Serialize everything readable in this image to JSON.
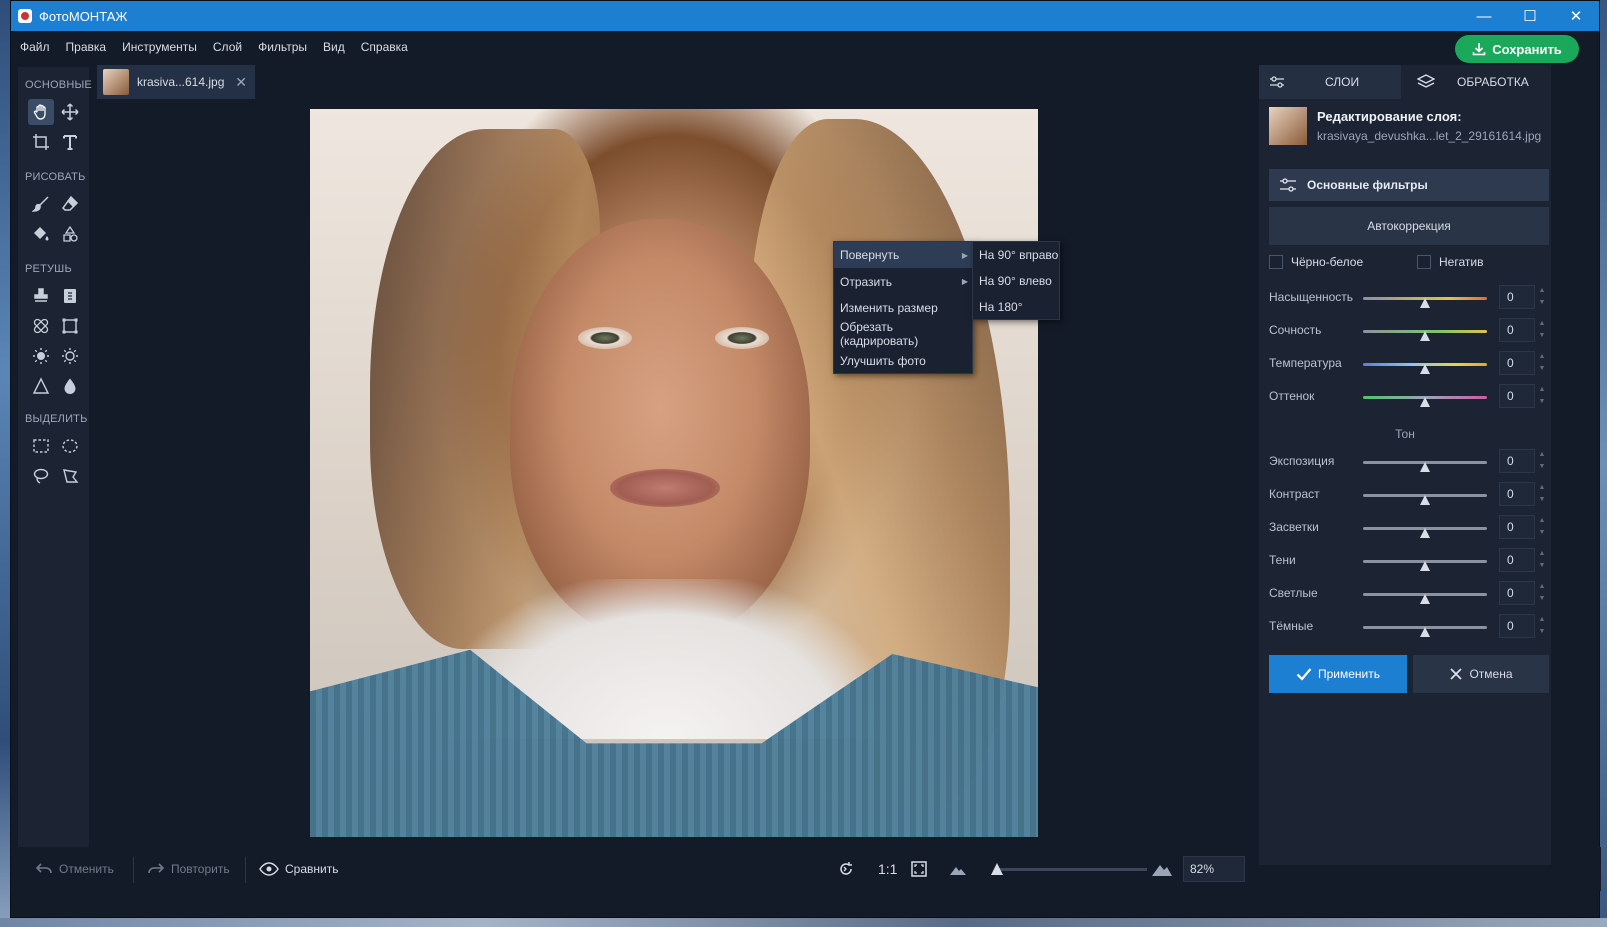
{
  "window": {
    "title": "ФотоМОНТАЖ",
    "minimize": "—",
    "maximize": "☐",
    "close": "✕"
  },
  "menu": [
    "Файл",
    "Правка",
    "Инструменты",
    "Слой",
    "Фильтры",
    "Вид",
    "Справка"
  ],
  "save_label": "Сохранить",
  "toolbox": {
    "sections": [
      "ОСНОВНЫЕ",
      "РИСОВАТЬ",
      "РЕТУШЬ",
      "ВЫДЕЛИТЬ"
    ]
  },
  "document_tab": {
    "name": "krasiva...614.jpg",
    "close": "✕"
  },
  "context_menu": {
    "items": [
      "Повернуть",
      "Отразить",
      "Изменить размер",
      "Обрезать (кадрировать)",
      "Улучшить фото"
    ],
    "submenu": [
      "На 90° вправо",
      "На 90° влево",
      "На 180°"
    ]
  },
  "bottom": {
    "undo": "Отменить",
    "redo": "Повторить",
    "compare": "Сравнить",
    "one_to_one": "1:1",
    "zoom": "82%"
  },
  "right_panel": {
    "tabs": [
      "СЛОИ",
      "ОБРАБОТКА"
    ],
    "layer_title": "Редактирование слоя:",
    "layer_file": "krasivaya_devushka...let_2_29161614.jpg",
    "section": "Основные фильтры",
    "auto": "Автокоррекция",
    "checks": [
      "Чёрно-белое",
      "Негатив"
    ],
    "color_sliders": [
      {
        "label": "Насыщенность",
        "value": "0"
      },
      {
        "label": "Сочность",
        "value": "0"
      },
      {
        "label": "Температура",
        "value": "0"
      },
      {
        "label": "Оттенок",
        "value": "0"
      }
    ],
    "tone_label": "Тон",
    "tone_sliders": [
      {
        "label": "Экспозиция",
        "value": "0"
      },
      {
        "label": "Контраст",
        "value": "0"
      },
      {
        "label": "Засветки",
        "value": "0"
      },
      {
        "label": "Тени",
        "value": "0"
      },
      {
        "label": "Светлые",
        "value": "0"
      },
      {
        "label": "Тёмные",
        "value": "0"
      }
    ],
    "apply": "Применить",
    "cancel": "Отмена"
  },
  "colors": {
    "accent": "#1d7fd1",
    "save": "#1aa85a",
    "background": "#141b28"
  }
}
